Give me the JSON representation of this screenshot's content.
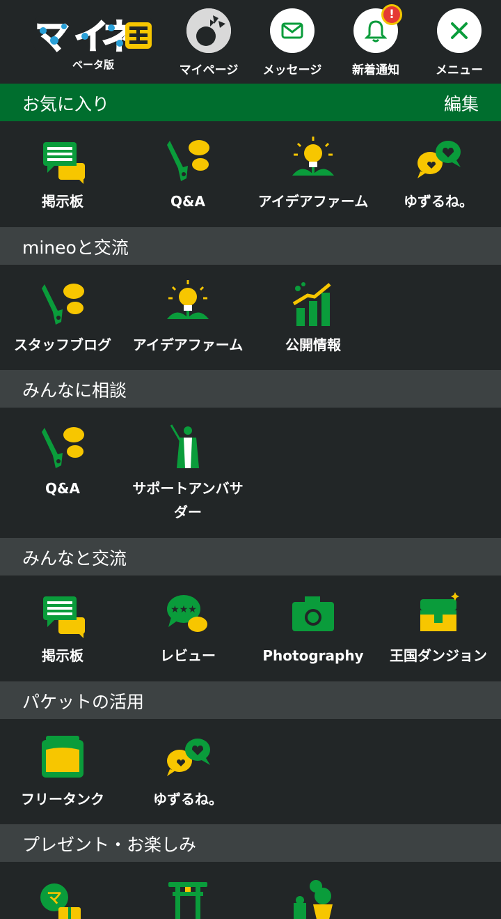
{
  "header": {
    "logo_text": "マイネ王",
    "logo_sub": "ベータ版",
    "mypage_label": "マイページ",
    "message_label": "メッセージ",
    "notify_label": "新着通知",
    "notify_badge": "!",
    "menu_label": "メニュー"
  },
  "favorites": {
    "title": "お気に入り",
    "edit_label": "編集",
    "items": [
      "掲示板",
      "Q&A",
      "アイデアファーム",
      "ゆずるね。"
    ]
  },
  "sections": [
    {
      "title": "mineoと交流",
      "items": [
        "スタッフブログ",
        "アイデアファーム",
        "公開情報"
      ]
    },
    {
      "title": "みんなに相談",
      "items": [
        "Q&A",
        "サポートアンバサダー"
      ]
    },
    {
      "title": "みんなと交流",
      "items": [
        "掲示板",
        "レビュー",
        "Photography",
        "王国ダンジョン"
      ]
    },
    {
      "title": "パケットの活用",
      "items": [
        "フリータンク",
        "ゆずるね。"
      ]
    },
    {
      "title": "プレゼント・お楽しみ"
    }
  ],
  "colors": {
    "green": "#0a9c3b",
    "dark_green": "#006e2e",
    "yellow": "#f7c600",
    "section_bg": "#3d4243",
    "page_bg": "#222627"
  }
}
